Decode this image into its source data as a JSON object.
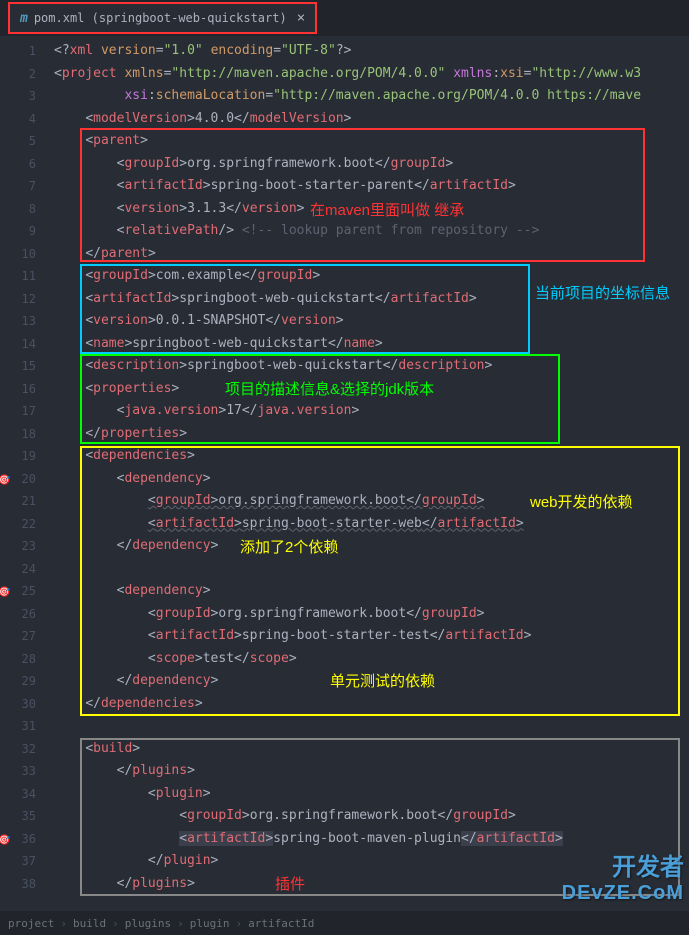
{
  "tab": {
    "icon": "m",
    "title": "pom.xml (springboot-web-quickstart)",
    "close": "×"
  },
  "lines": [
    {
      "n": "1",
      "html": "<span class='punc'>&lt;?</span><span class='tag'>xml</span> <span class='attr'>version</span><span class='punc'>=</span><span class='str'>\"1.0\"</span> <span class='attr'>encoding</span><span class='punc'>=</span><span class='str'>\"UTF-8\"</span><span class='punc'>?&gt;</span>"
    },
    {
      "n": "2",
      "html": "<span class='punc'>&lt;</span><span class='tag'>project</span> <span class='attr'>xmlns</span><span class='punc'>=</span><span class='str'>\"http://maven.apache.org/POM/4.0.0\"</span> <span class='ns'>xmlns</span><span class='punc'>:</span><span class='attr'>xsi</span><span class='punc'>=</span><span class='str'>\"http://www.w3</span>"
    },
    {
      "n": "3",
      "html": "         <span class='ns'>xsi</span><span class='punc'>:</span><span class='attr'>schemaLocation</span><span class='punc'>=</span><span class='str'>\"http://maven.apache.org/POM/4.0.0 https://mave</span>"
    },
    {
      "n": "4",
      "html": "    <span class='punc'>&lt;</span><span class='tag'>modelVersion</span><span class='punc'>&gt;</span><span class='text'>4.0.0</span><span class='punc'>&lt;/</span><span class='tag'>modelVersion</span><span class='punc'>&gt;</span>"
    },
    {
      "n": "5",
      "html": "    <span class='punc'>&lt;</span><span class='tag'>parent</span><span class='punc'>&gt;</span>"
    },
    {
      "n": "6",
      "html": "        <span class='punc'>&lt;</span><span class='tag'>groupId</span><span class='punc'>&gt;</span><span class='text'>org.springframework.boot</span><span class='punc'>&lt;/</span><span class='tag'>groupId</span><span class='punc'>&gt;</span>"
    },
    {
      "n": "7",
      "html": "        <span class='punc'>&lt;</span><span class='tag'>artifactId</span><span class='punc'>&gt;</span><span class='text'>spring-boot-starter-parent</span><span class='punc'>&lt;/</span><span class='tag'>artifactId</span><span class='punc'>&gt;</span>"
    },
    {
      "n": "8",
      "html": "        <span class='punc'>&lt;</span><span class='tag'>version</span><span class='punc'>&gt;</span><span class='text'>3.1.3</span><span class='punc'>&lt;/</span><span class='tag'>version</span><span class='punc'>&gt;</span>"
    },
    {
      "n": "9",
      "html": "        <span class='punc'>&lt;</span><span class='tag'>relativePath</span><span class='punc'>/&gt;</span> <span class='comment'>&lt;!-- lookup parent from repository --&gt;</span>"
    },
    {
      "n": "10",
      "html": "    <span class='punc'>&lt;/</span><span class='tag'>parent</span><span class='punc'>&gt;</span>"
    },
    {
      "n": "11",
      "html": "    <span class='punc'>&lt;</span><span class='tag'>groupId</span><span class='punc'>&gt;</span><span class='text'>com.example</span><span class='punc'>&lt;/</span><span class='tag'>groupId</span><span class='punc'>&gt;</span>"
    },
    {
      "n": "12",
      "html": "    <span class='punc'>&lt;</span><span class='tag'>artifactId</span><span class='punc'>&gt;</span><span class='text'>springboot-web-quickstart</span><span class='punc'>&lt;/</span><span class='tag'>artifactId</span><span class='punc'>&gt;</span>"
    },
    {
      "n": "13",
      "html": "    <span class='punc'>&lt;</span><span class='tag'>version</span><span class='punc'>&gt;</span><span class='text'>0.0.1-SNAPSHOT</span><span class='punc'>&lt;/</span><span class='tag'>version</span><span class='punc'>&gt;</span>"
    },
    {
      "n": "14",
      "html": "    <span class='punc'>&lt;</span><span class='tag'>name</span><span class='punc'>&gt;</span><span class='text'>springboot-web-quickstart</span><span class='punc'>&lt;/</span><span class='tag'>name</span><span class='punc'>&gt;</span>"
    },
    {
      "n": "15",
      "html": "    <span class='punc'>&lt;</span><span class='tag'>description</span><span class='punc'>&gt;</span><span class='text'>springboot-web-quickstart</span><span class='punc'>&lt;/</span><span class='tag'>description</span><span class='punc'>&gt;</span>"
    },
    {
      "n": "16",
      "html": "    <span class='punc'>&lt;</span><span class='tag'>properties</span><span class='punc'>&gt;</span>"
    },
    {
      "n": "17",
      "html": "        <span class='punc'>&lt;</span><span class='tag'>java.version</span><span class='punc'>&gt;</span><span class='text'>17</span><span class='punc'>&lt;/</span><span class='tag'>java.version</span><span class='punc'>&gt;</span>"
    },
    {
      "n": "18",
      "html": "    <span class='punc'>&lt;/</span><span class='tag'>properties</span><span class='punc'>&gt;</span>"
    },
    {
      "n": "19",
      "html": "    <span class='punc'>&lt;</span><span class='tag'>dependencies</span><span class='punc'>&gt;</span>"
    },
    {
      "n": "20",
      "mark": "🎯",
      "html": "        <span class='punc'>&lt;</span><span class='tag'>dependency</span><span class='punc'>&gt;</span>"
    },
    {
      "n": "21",
      "html": "            <span class='punc wavy'>&lt;</span><span class='tag wavy'>groupId</span><span class='punc wavy'>&gt;</span><span class='text wavy'>org.springframework.boot</span><span class='punc wavy'>&lt;/</span><span class='tag wavy'>groupId</span><span class='punc wavy'>&gt;</span>"
    },
    {
      "n": "22",
      "html": "            <span class='punc wavy'>&lt;</span><span class='tag wavy'>artifactId</span><span class='punc wavy'>&gt;</span><span class='text wavy'>spring-boot-starter-web</span><span class='punc wavy'>&lt;/</span><span class='tag wavy'>artifactId</span><span class='punc wavy'>&gt;</span>"
    },
    {
      "n": "23",
      "html": "        <span class='punc'>&lt;/</span><span class='tag'>dependency</span><span class='punc'>&gt;</span>"
    },
    {
      "n": "24",
      "html": ""
    },
    {
      "n": "25",
      "mark": "🎯",
      "html": "        <span class='punc'>&lt;</span><span class='tag'>dependency</span><span class='punc'>&gt;</span>"
    },
    {
      "n": "26",
      "html": "            <span class='punc'>&lt;</span><span class='tag'>groupId</span><span class='punc'>&gt;</span><span class='text'>org.springframework.boot</span><span class='punc'>&lt;/</span><span class='tag'>groupId</span><span class='punc'>&gt;</span>"
    },
    {
      "n": "27",
      "html": "            <span class='punc'>&lt;</span><span class='tag'>artifactId</span><span class='punc'>&gt;</span><span class='text'>spring-boot-starter-test</span><span class='punc'>&lt;/</span><span class='tag'>artifactId</span><span class='punc'>&gt;</span>"
    },
    {
      "n": "28",
      "html": "            <span class='punc'>&lt;</span><span class='tag'>scope</span><span class='punc'>&gt;</span><span class='text'>test</span><span class='punc'>&lt;/</span><span class='tag'>scope</span><span class='punc'>&gt;</span>"
    },
    {
      "n": "29",
      "html": "        <span class='punc'>&lt;/</span><span class='tag'>dependency</span><span class='punc'>&gt;</span>"
    },
    {
      "n": "30",
      "html": "    <span class='punc'>&lt;/</span><span class='tag'>dependencies</span><span class='punc'>&gt;</span>"
    },
    {
      "n": "31",
      "html": ""
    },
    {
      "n": "32",
      "html": "    <span class='punc'>&lt;</span><span class='tag'>build</span><span class='punc'>&gt;</span>"
    },
    {
      "n": "33",
      "html": "        <span class='punc'>&lt;/</span><span class='tag'>plugins</span><span class='punc'>&gt;</span>"
    },
    {
      "n": "34",
      "html": "            <span class='punc'>&lt;</span><span class='tag'>plugin</span><span class='punc'>&gt;</span>"
    },
    {
      "n": "35",
      "html": "                <span class='punc'>&lt;</span><span class='tag'>groupId</span><span class='punc'>&gt;</span><span class='text'>org.springframework.boot</span><span class='punc'>&lt;/</span><span class='tag'>groupId</span><span class='punc'>&gt;</span>"
    },
    {
      "n": "36",
      "mark": "🎯",
      "html": "                <span style='background:#3a3f4b'><span class='punc'>&lt;</span><span class='tag'>artifactId</span><span class='punc'>&gt;</span></span><span class='text'>spring-boot-maven-plugin</span><span style='background:#3a3f4b'><span class='punc'>&lt;/</span><span class='tag'>artifactId</span><span class='punc'>&gt;</span></span>"
    },
    {
      "n": "37",
      "html": "            <span class='punc'>&lt;/</span><span class='tag'>plugin</span><span class='punc'>&gt;</span>"
    },
    {
      "n": "38",
      "html": "        <span class='punc'>&lt;/</span><span class='tag'>plugins</span><span class='punc'>&gt;</span>"
    }
  ],
  "annotations": {
    "red_text": "在maven里面叫做 继承",
    "cyan_text": "当前项目的坐标信息",
    "green_text": "项目的描述信息&选择的jdk版本",
    "yellow_text1": "web开发的依赖",
    "yellow_text2": "添加了2个依赖",
    "yellow_text3": "单元测试的依赖",
    "red_text2": "插件"
  },
  "breadcrumb": [
    "project",
    "build",
    "plugins",
    "plugin",
    "artifactId"
  ],
  "watermark": {
    "line1": "开发者",
    "line2": "DEvZE.CoM"
  }
}
